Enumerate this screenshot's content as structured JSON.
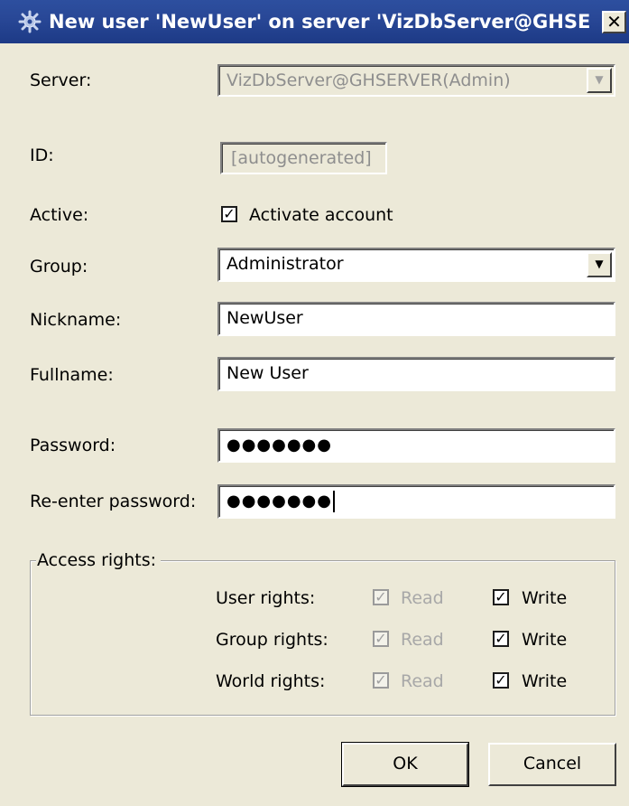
{
  "window": {
    "title": "New user 'NewUser' on server 'VizDbServer@GHSERV...",
    "close_glyph": "✕"
  },
  "form": {
    "server": {
      "label": "Server:",
      "value": "VizDbServer@GHSERVER(Admin)"
    },
    "id": {
      "label": "ID:",
      "value": "[autogenerated]"
    },
    "active": {
      "label": "Active:",
      "checkbox_label": "Activate account",
      "checked": true
    },
    "group": {
      "label": "Group:",
      "value": "Administrator"
    },
    "nickname": {
      "label": "Nickname:",
      "value": "NewUser"
    },
    "fullname": {
      "label": "Fullname:",
      "value": "New User"
    },
    "password": {
      "label": "Password:",
      "masked": "●●●●●●●"
    },
    "reenter_password": {
      "label": "Re-enter password:",
      "masked": "●●●●●●●"
    }
  },
  "access_rights": {
    "title": "Access rights:",
    "read_label": "Read",
    "write_label": "Write",
    "rows": [
      {
        "label": "User rights:",
        "read": true,
        "read_enabled": false,
        "write": true
      },
      {
        "label": "Group rights:",
        "read": true,
        "read_enabled": false,
        "write": true
      },
      {
        "label": "World rights:",
        "read": true,
        "read_enabled": false,
        "write": true
      }
    ]
  },
  "buttons": {
    "ok": "OK",
    "cancel": "Cancel"
  },
  "icons": {
    "window": "gear-icon",
    "close": "close-icon",
    "dropdown": "chevron-down-icon",
    "checkmark": "checkmark-icon"
  },
  "colors": {
    "titlebar": "#294897",
    "dialog_background": "#ece9d8",
    "field_background": "#ffffff",
    "disabled_text": "#8e8e8e"
  }
}
